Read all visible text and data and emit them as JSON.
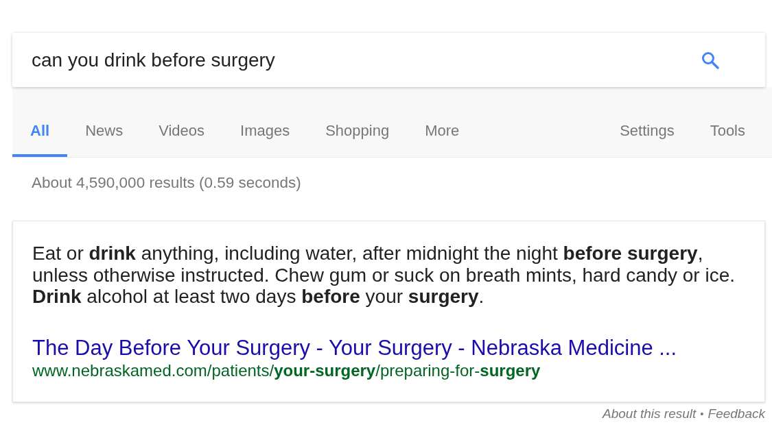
{
  "search": {
    "value": "can you drink before surgery"
  },
  "tabs": [
    {
      "label": "All",
      "selected": true
    },
    {
      "label": "News",
      "selected": false
    },
    {
      "label": "Videos",
      "selected": false
    },
    {
      "label": "Images",
      "selected": false
    },
    {
      "label": "Shopping",
      "selected": false
    },
    {
      "label": "More",
      "selected": false
    }
  ],
  "tools_menu": [
    "Settings",
    "Tools"
  ],
  "result_stats": "About 4,590,000 results (0.59 seconds)",
  "featured_snippet": {
    "text": "Eat or **drink** anything, including water, after midnight the night **before surgery**, unless otherwise instructed. Chew gum or suck on breath mints, hard candy or ice. **Drink** alcohol at least two days **before** your **surgery**.",
    "title": "The Day Before Your Surgery - Your Surgery - Nebraska Medicine ...",
    "url": "www.nebraskamed.com/patients/**your-surgery**/preparing-for-**surgery**"
  },
  "footer": {
    "about": "About this result",
    "separator": "•",
    "feedback": "Feedback"
  }
}
